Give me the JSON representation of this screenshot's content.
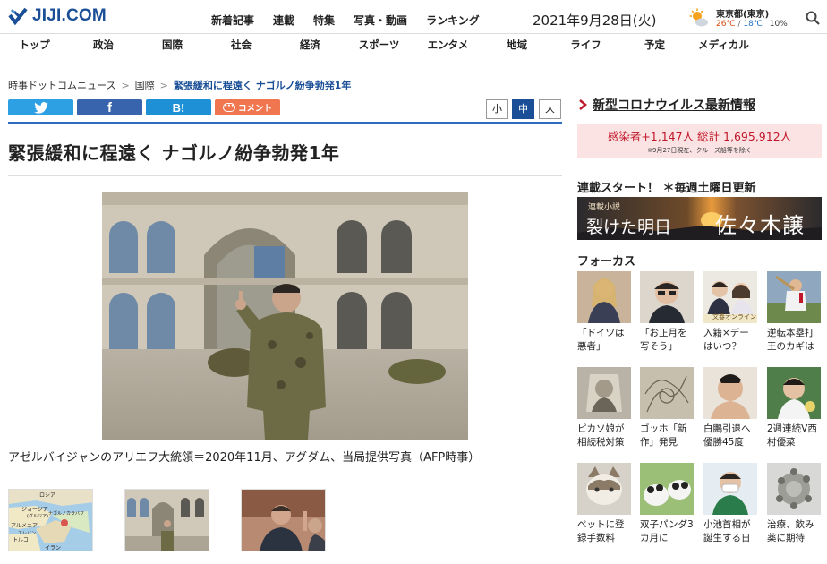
{
  "header": {
    "logo_text": "JIJI.COM",
    "top_links": [
      "新着記事",
      "連載",
      "特集",
      "写真・動画",
      "ランキング"
    ],
    "date": "2021年9月28日(火)",
    "weather": {
      "city": "東京都(東京)",
      "high": "26℃",
      "separator": "/",
      "low": "18℃",
      "rain_chance": "10%"
    }
  },
  "categories": [
    "トップ",
    "政治",
    "国際",
    "社会",
    "経済",
    "スポーツ",
    "エンタメ",
    "地域",
    "ライフ",
    "予定",
    "メディカル"
  ],
  "breadcrumb": {
    "items": [
      "時事ドットコムニュース",
      "国際",
      "緊張緩和に程遠く ナゴルノ紛争勃発1年"
    ],
    "separator": ">"
  },
  "share": {
    "twitter_icon": "twitter-bird-icon",
    "facebook_label": "f",
    "hatena_label": "B!",
    "comment_label": "コメント"
  },
  "font_size": {
    "small": "小",
    "medium": "中",
    "large": "大"
  },
  "article": {
    "headline": "緊張緩和に程遠く ナゴルノ紛争勃発1年",
    "caption": "アゼルバイジャンのアリエフ大統領＝2020年11月、アグダム、当局提供写真（AFP時事）"
  },
  "thumbnails": {
    "map_labels": [
      "ロシア",
      "ジョージア",
      "(グルジア)",
      "ナゴルノカラバフ",
      "アルメニア",
      "エレバン",
      "トルコ",
      "イラン"
    ]
  },
  "sidebar": {
    "covid": {
      "title": "新型コロナウイルス最新情報",
      "counts": "感染者+1,147人 総計 1,695,912人",
      "note": "※9月27日現在、クルーズ船等を除く"
    },
    "serial": {
      "title": "連載スタート！ ＊毎週土曜日更新",
      "small": "連載小説",
      "main": "裂けた明日",
      "author": "佐々木譲"
    },
    "focus": {
      "title": "フォーカス",
      "items": [
        {
          "text": "「ドイツは悪者」"
        },
        {
          "text": "「お正月を写そう」"
        },
        {
          "text": "入籍×デーはいつ？"
        },
        {
          "text": "逆転本塁打王のカギは"
        },
        {
          "text": "ピカソ娘が相続税対策"
        },
        {
          "text": "ゴッホ「新作」発見"
        },
        {
          "text": "白鵬引退へ優勝45度"
        },
        {
          "text": "2週連続V西村優菜"
        },
        {
          "text": "ペットに登録手数料"
        },
        {
          "text": "双子パンダ3カ月に"
        },
        {
          "text": "小池首相が誕生する日"
        },
        {
          "text": "治療、飲み薬に期待"
        }
      ],
      "overlay_label": "文春オンライン"
    }
  },
  "colors": {
    "brand": "#1a4f97",
    "accent_red": "#c0182a",
    "twitter": "#2d9fe3",
    "facebook": "#3764ac",
    "hatena": "#1e91d6",
    "comment": "#f07650"
  }
}
